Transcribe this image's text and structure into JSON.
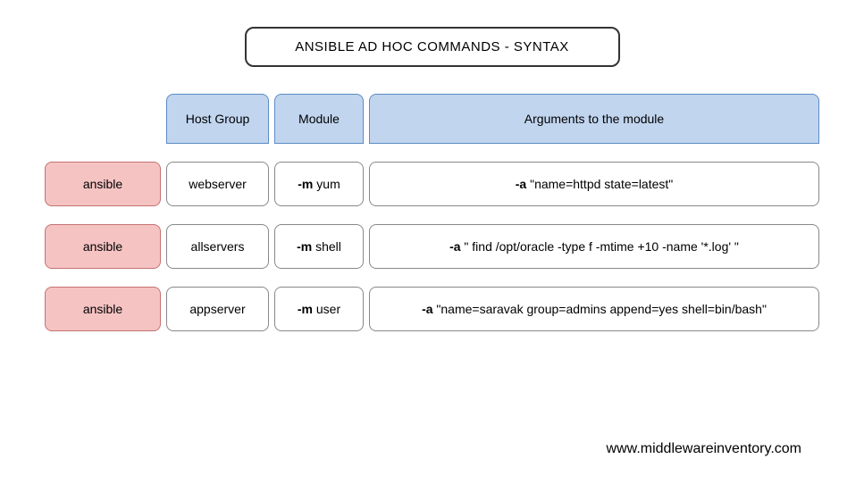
{
  "title": "ANSIBLE AD HOC COMMANDS - SYNTAX",
  "headers": {
    "hostgroup": "Host Group",
    "module": "Module",
    "arguments": "Arguments to the module"
  },
  "command_label": "ansible",
  "module_flag": "-m",
  "args_flag": "-a",
  "rows": [
    {
      "host": "webserver",
      "module": "yum",
      "args": "\"name=httpd state=latest\""
    },
    {
      "host": "allservers",
      "module": "shell",
      "args": "\" find /opt/oracle -type f -mtime +10 -name '*.log' \""
    },
    {
      "host": "appserver",
      "module": "user",
      "args": "\"name=saravak group=admins append=yes shell=bin/bash\""
    }
  ],
  "footer": "www.middlewareinventory.com"
}
